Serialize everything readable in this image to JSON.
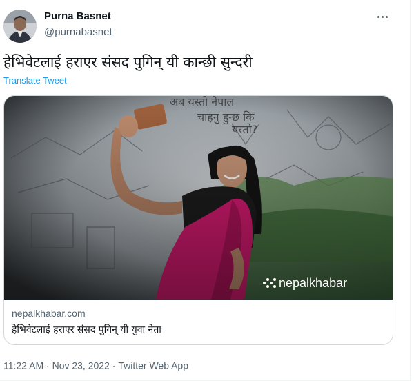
{
  "author": {
    "name": "Purna Basnet",
    "handle": "@purnabasnet"
  },
  "tweet": {
    "text": "हेभिवेटलाई हराएर संसद पुगिन् यी कान्छी सुन्दरी",
    "translate_label": "Translate Tweet"
  },
  "card": {
    "image_logo_text": "nepalkhabar",
    "domain": "nepalkhabar.com",
    "title": "हेभिवेटलाई हराएर संसद पुगिन् यी युवा नेता"
  },
  "meta": {
    "time": "11:22 AM",
    "separator": "·",
    "date": "Nov 23, 2022",
    "source": "Twitter Web App"
  },
  "colors": {
    "accent": "#1d9bf0",
    "saree": "#d81b72"
  }
}
